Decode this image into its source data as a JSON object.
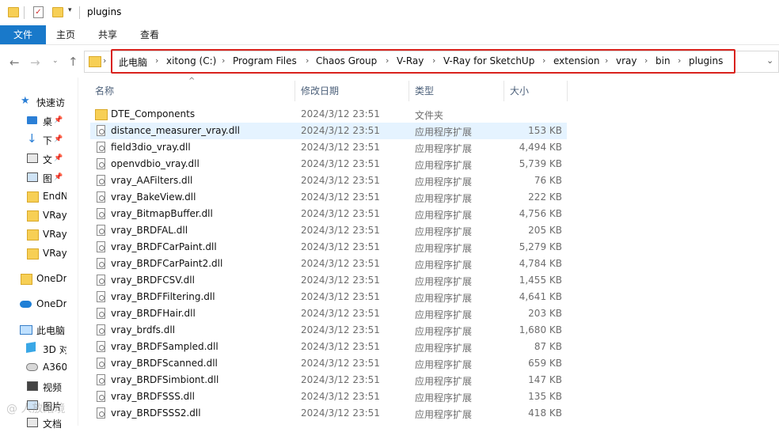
{
  "window": {
    "title": "plugins"
  },
  "ribbon": {
    "tabs": [
      "文件",
      "主页",
      "共享",
      "查看"
    ]
  },
  "address": {
    "crumbs": [
      "此电脑",
      "xitong (C:)",
      "Program Files",
      "Chaos Group",
      "V-Ray",
      "V-Ray for SketchUp",
      "extension",
      "vray",
      "bin",
      "plugins"
    ]
  },
  "sidebar": {
    "items": [
      {
        "label": "快速访",
        "icon": "star-icon"
      },
      {
        "label": "桌",
        "icon": "desktop-icon",
        "pinned": true
      },
      {
        "label": "下",
        "icon": "download-icon",
        "pinned": true
      },
      {
        "label": "文",
        "icon": "document-icon",
        "pinned": true
      },
      {
        "label": "图",
        "icon": "picture-icon",
        "pinned": true
      },
      {
        "label": "EndN",
        "icon": "folder-icon"
      },
      {
        "label": "VRay",
        "icon": "folder-icon"
      },
      {
        "label": "VRay",
        "icon": "folder-icon"
      },
      {
        "label": "VRay",
        "icon": "folder-icon"
      },
      {
        "label": "OneDr",
        "icon": "folder-icon"
      },
      {
        "label": "OneDr",
        "icon": "onedrive-cloud-icon"
      },
      {
        "label": "此电脑",
        "icon": "this-pc-icon"
      },
      {
        "label": "3D 对",
        "icon": "3d-objects-icon"
      },
      {
        "label": "A360",
        "icon": "network-drive-icon"
      },
      {
        "label": "视频",
        "icon": "video-icon"
      },
      {
        "label": "图片",
        "icon": "picture-icon"
      },
      {
        "label": "文档",
        "icon": "document-icon"
      }
    ]
  },
  "columns": {
    "name": "名称",
    "date": "修改日期",
    "type": "类型",
    "size": "大小"
  },
  "files": [
    {
      "name": "DTE_Components",
      "date": "2024/3/12 23:51",
      "type": "文件夹",
      "size": "",
      "kind": "folder"
    },
    {
      "name": "distance_measurer_vray.dll",
      "date": "2024/3/12 23:51",
      "type": "应用程序扩展",
      "size": "153 KB",
      "kind": "dll",
      "selected": true
    },
    {
      "name": "field3dio_vray.dll",
      "date": "2024/3/12 23:51",
      "type": "应用程序扩展",
      "size": "4,494 KB",
      "kind": "dll"
    },
    {
      "name": "openvdbio_vray.dll",
      "date": "2024/3/12 23:51",
      "type": "应用程序扩展",
      "size": "5,739 KB",
      "kind": "dll"
    },
    {
      "name": "vray_AAFilters.dll",
      "date": "2024/3/12 23:51",
      "type": "应用程序扩展",
      "size": "76 KB",
      "kind": "dll"
    },
    {
      "name": "vray_BakeView.dll",
      "date": "2024/3/12 23:51",
      "type": "应用程序扩展",
      "size": "222 KB",
      "kind": "dll"
    },
    {
      "name": "vray_BitmapBuffer.dll",
      "date": "2024/3/12 23:51",
      "type": "应用程序扩展",
      "size": "4,756 KB",
      "kind": "dll"
    },
    {
      "name": "vray_BRDFAL.dll",
      "date": "2024/3/12 23:51",
      "type": "应用程序扩展",
      "size": "205 KB",
      "kind": "dll"
    },
    {
      "name": "vray_BRDFCarPaint.dll",
      "date": "2024/3/12 23:51",
      "type": "应用程序扩展",
      "size": "5,279 KB",
      "kind": "dll"
    },
    {
      "name": "vray_BRDFCarPaint2.dll",
      "date": "2024/3/12 23:51",
      "type": "应用程序扩展",
      "size": "4,784 KB",
      "kind": "dll"
    },
    {
      "name": "vray_BRDFCSV.dll",
      "date": "2024/3/12 23:51",
      "type": "应用程序扩展",
      "size": "1,455 KB",
      "kind": "dll"
    },
    {
      "name": "vray_BRDFFiltering.dll",
      "date": "2024/3/12 23:51",
      "type": "应用程序扩展",
      "size": "4,641 KB",
      "kind": "dll"
    },
    {
      "name": "vray_BRDFHair.dll",
      "date": "2024/3/12 23:51",
      "type": "应用程序扩展",
      "size": "203 KB",
      "kind": "dll"
    },
    {
      "name": "vray_brdfs.dll",
      "date": "2024/3/12 23:51",
      "type": "应用程序扩展",
      "size": "1,680 KB",
      "kind": "dll"
    },
    {
      "name": "vray_BRDFSampled.dll",
      "date": "2024/3/12 23:51",
      "type": "应用程序扩展",
      "size": "87 KB",
      "kind": "dll"
    },
    {
      "name": "vray_BRDFScanned.dll",
      "date": "2024/3/12 23:51",
      "type": "应用程序扩展",
      "size": "659 KB",
      "kind": "dll"
    },
    {
      "name": "vray_BRDFSimbiont.dll",
      "date": "2024/3/12 23:51",
      "type": "应用程序扩展",
      "size": "147 KB",
      "kind": "dll"
    },
    {
      "name": "vray_BRDFSSS.dll",
      "date": "2024/3/12 23:51",
      "type": "应用程序扩展",
      "size": "135 KB",
      "kind": "dll"
    },
    {
      "name": "vray_BRDFSSS2.dll",
      "date": "2024/3/12 23:51",
      "type": "应用程序扩展",
      "size": "418 KB",
      "kind": "dll"
    }
  ],
  "watermark": "@ 人放踏境",
  "colors": {
    "accent": "#1979ca",
    "highlight_border": "#d9221d",
    "selection": "#e5f3ff",
    "folder": "#f7cf55"
  }
}
